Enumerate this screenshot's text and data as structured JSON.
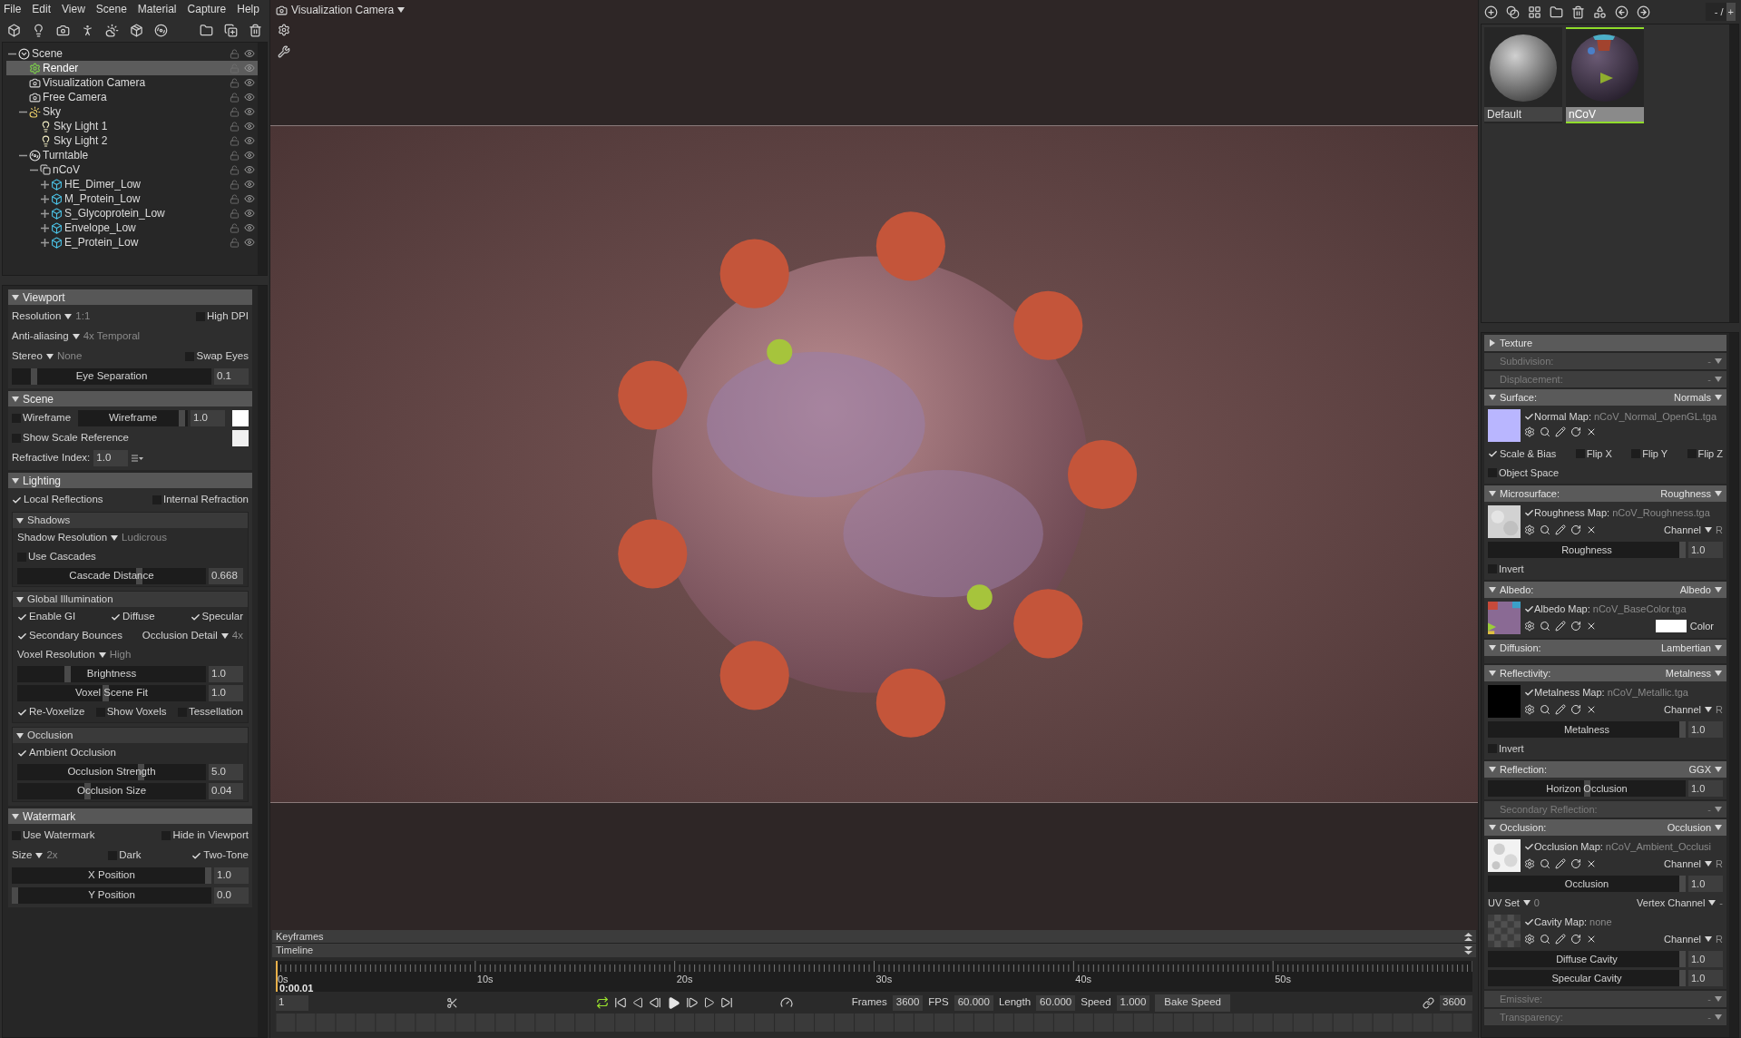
{
  "menu": [
    "File",
    "Edit",
    "View",
    "Scene",
    "Material",
    "Capture",
    "Help"
  ],
  "scene_tree": [
    {
      "label": "Scene",
      "kind": "scene",
      "selected": false,
      "expanded": true,
      "children": [
        {
          "label": "Render",
          "kind": "render",
          "selected": true
        },
        {
          "label": "Visualization Camera",
          "kind": "camera",
          "selected": false
        },
        {
          "label": "Free Camera",
          "kind": "camera",
          "selected": false
        },
        {
          "label": "Sky",
          "kind": "sky",
          "selected": false,
          "expanded": true,
          "children": [
            {
              "label": "Sky Light 1",
              "kind": "light",
              "selected": false
            },
            {
              "label": "Sky Light 2",
              "kind": "light",
              "selected": false
            }
          ]
        },
        {
          "label": "Turntable",
          "kind": "turntable",
          "selected": false,
          "expanded": true,
          "children": [
            {
              "label": "nCoV",
              "kind": "group",
              "selected": false,
              "expanded": true,
              "children": [
                {
                  "label": "HE_Dimer_Low",
                  "kind": "mesh",
                  "selected": false,
                  "expanded": false
                },
                {
                  "label": "M_Protein_Low",
                  "kind": "mesh",
                  "selected": false,
                  "expanded": false
                },
                {
                  "label": "S_Glycoprotein_Low",
                  "kind": "mesh",
                  "selected": false,
                  "expanded": false
                },
                {
                  "label": "Envelope_Low",
                  "kind": "mesh",
                  "selected": false,
                  "expanded": false
                },
                {
                  "label": "E_Protein_Low",
                  "kind": "mesh",
                  "selected": false,
                  "expanded": false
                }
              ]
            }
          ]
        }
      ]
    }
  ],
  "panels": [
    {
      "title": "Viewport",
      "expanded": true,
      "rows": [
        {
          "kind": "line",
          "items": [
            {
              "kind": "dropdown",
              "label": "Resolution",
              "value": "1:1"
            },
            {
              "kind": "check",
              "label": "High DPI",
              "checked": false
            }
          ]
        },
        {
          "kind": "line",
          "items": [
            {
              "kind": "dropdown",
              "label": "Anti-aliasing",
              "value": "4x Temporal"
            }
          ]
        },
        {
          "kind": "line",
          "items": [
            {
              "kind": "dropdown",
              "label": "Stereo",
              "value": "None"
            },
            {
              "kind": "check",
              "label": "Swap Eyes",
              "checked": false
            }
          ]
        },
        {
          "kind": "line",
          "items": [
            {
              "kind": "slider",
              "label": "Eye Separation",
              "level": 0.1,
              "value": "0.1"
            }
          ]
        }
      ]
    },
    {
      "title": "Scene",
      "expanded": true,
      "rows": [
        {
          "kind": "line",
          "items": [
            {
              "kind": "check",
              "label": "Wireframe",
              "checked": false
            },
            {
              "kind": "slider",
              "label": "Wireframe",
              "level": 0.97,
              "value": "1.0"
            },
            {
              "kind": "swatch",
              "color": "#ffffff"
            }
          ]
        },
        {
          "kind": "line",
          "items": [
            {
              "kind": "check",
              "label": "Show Scale Reference",
              "checked": false
            },
            {
              "kind": "swatch",
              "color": "#f0f0f0"
            }
          ]
        },
        {
          "kind": "line",
          "items": [
            {
              "kind": "field",
              "label": "Refractive Index:",
              "value": "1.0",
              "menu": true
            }
          ]
        }
      ]
    },
    {
      "title": "Lighting",
      "expanded": true,
      "rows": [
        {
          "kind": "line",
          "items": [
            {
              "kind": "check",
              "label": "Local Reflections",
              "checked": true
            },
            {
              "kind": "check",
              "label": "Internal Refraction",
              "checked": false
            }
          ]
        },
        {
          "kind": "group",
          "title": "Shadows",
          "expanded": true,
          "rows": [
            {
              "kind": "line",
              "items": [
                {
                  "kind": "dropdown",
                  "label": "Shadow Resolution",
                  "value": "Ludicrous"
                }
              ]
            },
            {
              "kind": "line",
              "items": [
                {
                  "kind": "check",
                  "label": "Use Cascades",
                  "checked": false
                }
              ]
            },
            {
              "kind": "line",
              "items": [
                {
                  "kind": "slider",
                  "label": "Cascade Distance",
                  "level": 0.65,
                  "value": "0.668"
                }
              ]
            }
          ]
        },
        {
          "kind": "group",
          "title": "Global Illumination",
          "expanded": true,
          "rows": [
            {
              "kind": "line",
              "items": [
                {
                  "kind": "check",
                  "label": "Enable GI",
                  "checked": true
                },
                {
                  "kind": "check",
                  "label": "Diffuse",
                  "checked": true
                },
                {
                  "kind": "check",
                  "label": "Specular",
                  "checked": true
                }
              ]
            },
            {
              "kind": "line",
              "items": [
                {
                  "kind": "check",
                  "label": "Secondary Bounces",
                  "checked": true
                },
                {
                  "kind": "dropdown",
                  "label": "Occlusion Detail",
                  "value": "4x"
                }
              ]
            },
            {
              "kind": "line",
              "items": [
                {
                  "kind": "dropdown",
                  "label": "Voxel Resolution",
                  "value": "High"
                }
              ]
            },
            {
              "kind": "line",
              "items": [
                {
                  "kind": "slider",
                  "label": "Brightness",
                  "level": 0.26,
                  "value": "1.0"
                }
              ]
            },
            {
              "kind": "line",
              "items": [
                {
                  "kind": "slider",
                  "label": "Voxel Scene Fit",
                  "level": 0.47,
                  "value": "1.0"
                }
              ]
            },
            {
              "kind": "line",
              "items": [
                {
                  "kind": "check",
                  "label": "Re-Voxelize",
                  "checked": true
                },
                {
                  "kind": "check",
                  "label": "Show Voxels",
                  "checked": false
                },
                {
                  "kind": "check",
                  "label": "Tessellation",
                  "checked": false
                }
              ]
            }
          ]
        },
        {
          "kind": "group",
          "title": "Occlusion",
          "expanded": true,
          "rows": [
            {
              "kind": "line",
              "items": [
                {
                  "kind": "check",
                  "label": "Ambient Occlusion",
                  "checked": true
                }
              ]
            },
            {
              "kind": "line",
              "items": [
                {
                  "kind": "slider",
                  "label": "Occlusion Strength",
                  "level": 0.66,
                  "value": "5.0"
                }
              ]
            },
            {
              "kind": "line",
              "items": [
                {
                  "kind": "slider",
                  "label": "Occlusion Size",
                  "level": 0.37,
                  "value": "0.04"
                }
              ]
            }
          ]
        }
      ]
    },
    {
      "title": "Watermark",
      "expanded": true,
      "rows": [
        {
          "kind": "line",
          "items": [
            {
              "kind": "check",
              "label": "Use Watermark",
              "checked": false
            },
            {
              "kind": "check",
              "label": "Hide in Viewport",
              "checked": false
            }
          ]
        },
        {
          "kind": "line",
          "items": [
            {
              "kind": "dropdown",
              "label": "Size",
              "value": "2x"
            },
            {
              "kind": "check",
              "label": "Dark",
              "checked": false
            },
            {
              "kind": "check",
              "label": "Two-Tone",
              "checked": true
            }
          ]
        },
        {
          "kind": "line",
          "items": [
            {
              "kind": "slider",
              "label": "X Position",
              "level": 1,
              "value": "1.0"
            }
          ]
        },
        {
          "kind": "line",
          "items": [
            {
              "kind": "slider",
              "label": "Y Position",
              "level": 0,
              "value": "0.0"
            }
          ]
        }
      ]
    }
  ],
  "viewport": {
    "camera": "Visualization Camera"
  },
  "timeline": {
    "keyframes_title": "Keyframes",
    "title": "Timeline",
    "ticks": [
      "0s",
      "10s",
      "20s",
      "30s",
      "40s",
      "50s"
    ],
    "current_time": "0:00.01",
    "level": 0,
    "frame": "1",
    "loop": true,
    "frames_label": "Frames",
    "frames": "3600",
    "fps_label": "FPS",
    "fps": "60.000",
    "length_label": "Length",
    "length": "60.000",
    "speed_label": "Speed",
    "speed": "1.000",
    "bake_button": "Bake Speed",
    "end_frame": "3600"
  },
  "material_counter": {
    "text": "- /",
    "button": "+"
  },
  "materials": [
    {
      "name": "Default",
      "selected": false
    },
    {
      "name": "nCoV",
      "selected": true
    }
  ],
  "material_panels": [
    {
      "title": "Texture",
      "disabled": false,
      "expanded": false
    },
    {
      "title": "Subdivision:",
      "value": "-",
      "disabled": true
    },
    {
      "title": "Displacement:",
      "value": "-",
      "disabled": true
    },
    {
      "title": "Surface:",
      "value": "Normals",
      "disabled": false,
      "expanded": true,
      "rows": [
        {
          "kind": "map",
          "label": "Normal Map:",
          "checked": true,
          "file": "nCoV_Normal_OpenGL.tga"
        },
        {
          "kind": "line",
          "items": [
            {
              "kind": "check",
              "label": "Scale & Bias",
              "checked": true
            },
            {
              "kind": "check",
              "label": "Flip X",
              "checked": false
            },
            {
              "kind": "check",
              "label": "Flip Y",
              "checked": false
            },
            {
              "kind": "check",
              "label": "Flip Z",
              "checked": false
            }
          ]
        },
        {
          "kind": "line",
          "items": [
            {
              "kind": "check",
              "label": "Object Space",
              "checked": false
            }
          ]
        }
      ]
    },
    {
      "title": "Microsurface:",
      "value": "Roughness",
      "disabled": false,
      "expanded": true,
      "rows": [
        {
          "kind": "map",
          "label": "Roughness Map:",
          "checked": true,
          "file": "nCoV_Roughness.tga",
          "channel": {
            "label": "Channel",
            "value": "R"
          }
        },
        {
          "kind": "line",
          "items": [
            {
              "kind": "slider",
              "label": "Roughness",
              "level": 1,
              "value": "1.0"
            }
          ]
        },
        {
          "kind": "line",
          "items": [
            {
              "kind": "check",
              "label": "Invert",
              "checked": false
            }
          ]
        }
      ]
    },
    {
      "title": "Albedo:",
      "value": "Albedo",
      "disabled": false,
      "expanded": true,
      "rows": [
        {
          "kind": "map",
          "label": "Albedo Map:",
          "checked": true,
          "file": "nCoV_BaseColor.tga",
          "swatch": {
            "color": "#ffffff",
            "label": "Color"
          }
        }
      ]
    },
    {
      "title": "Diffusion:",
      "value": "Lambertian",
      "disabled": false,
      "expanded": true
    },
    {
      "title": "Reflectivity:",
      "value": "Metalness",
      "disabled": false,
      "expanded": true,
      "rows": [
        {
          "kind": "map",
          "label": "Metalness Map:",
          "checked": true,
          "file": "nCoV_Metallic.tga",
          "channel": {
            "label": "Channel",
            "value": "R"
          }
        },
        {
          "kind": "line",
          "items": [
            {
              "kind": "slider",
              "label": "Metalness",
              "level": 1,
              "value": "1.0"
            }
          ]
        },
        {
          "kind": "line",
          "items": [
            {
              "kind": "check",
              "label": "Invert",
              "checked": false
            }
          ]
        }
      ]
    },
    {
      "title": "Reflection:",
      "value": "GGX",
      "disabled": false,
      "expanded": true,
      "rows": [
        {
          "kind": "line",
          "items": [
            {
              "kind": "slider",
              "label": "Horizon Occlusion",
              "level": 0.5,
              "value": "1.0"
            }
          ]
        }
      ]
    },
    {
      "title": "Secondary Reflection:",
      "value": "-",
      "disabled": true
    },
    {
      "title": "Occlusion:",
      "value": "Occlusion",
      "disabled": false,
      "expanded": true,
      "rows": [
        {
          "kind": "map",
          "label": "Occlusion Map:",
          "checked": true,
          "file": "nCoV_Ambient_Occlusi",
          "channel": {
            "label": "Channel",
            "value": "R"
          }
        },
        {
          "kind": "line",
          "items": [
            {
              "kind": "slider",
              "label": "Occlusion",
              "level": 1,
              "value": "1.0"
            }
          ]
        },
        {
          "kind": "line",
          "items": [
            {
              "kind": "dropdown",
              "label": "UV Set",
              "value": "0"
            },
            {
              "kind": "dropdown",
              "label": "Vertex Channel",
              "value": "-"
            }
          ]
        },
        {
          "kind": "map",
          "label": "Cavity Map:",
          "checked": true,
          "file": "none",
          "channel": {
            "label": "Channel",
            "value": "R"
          }
        },
        {
          "kind": "line",
          "items": [
            {
              "kind": "slider",
              "label": "Diffuse Cavity",
              "level": 1,
              "value": "1.0"
            }
          ]
        },
        {
          "kind": "line",
          "items": [
            {
              "kind": "slider",
              "label": "Specular Cavity",
              "level": 1,
              "value": "1.0"
            }
          ]
        }
      ]
    },
    {
      "title": "Emissive:",
      "value": "-",
      "disabled": true
    },
    {
      "title": "Transparency:",
      "value": "-",
      "disabled": true
    }
  ]
}
